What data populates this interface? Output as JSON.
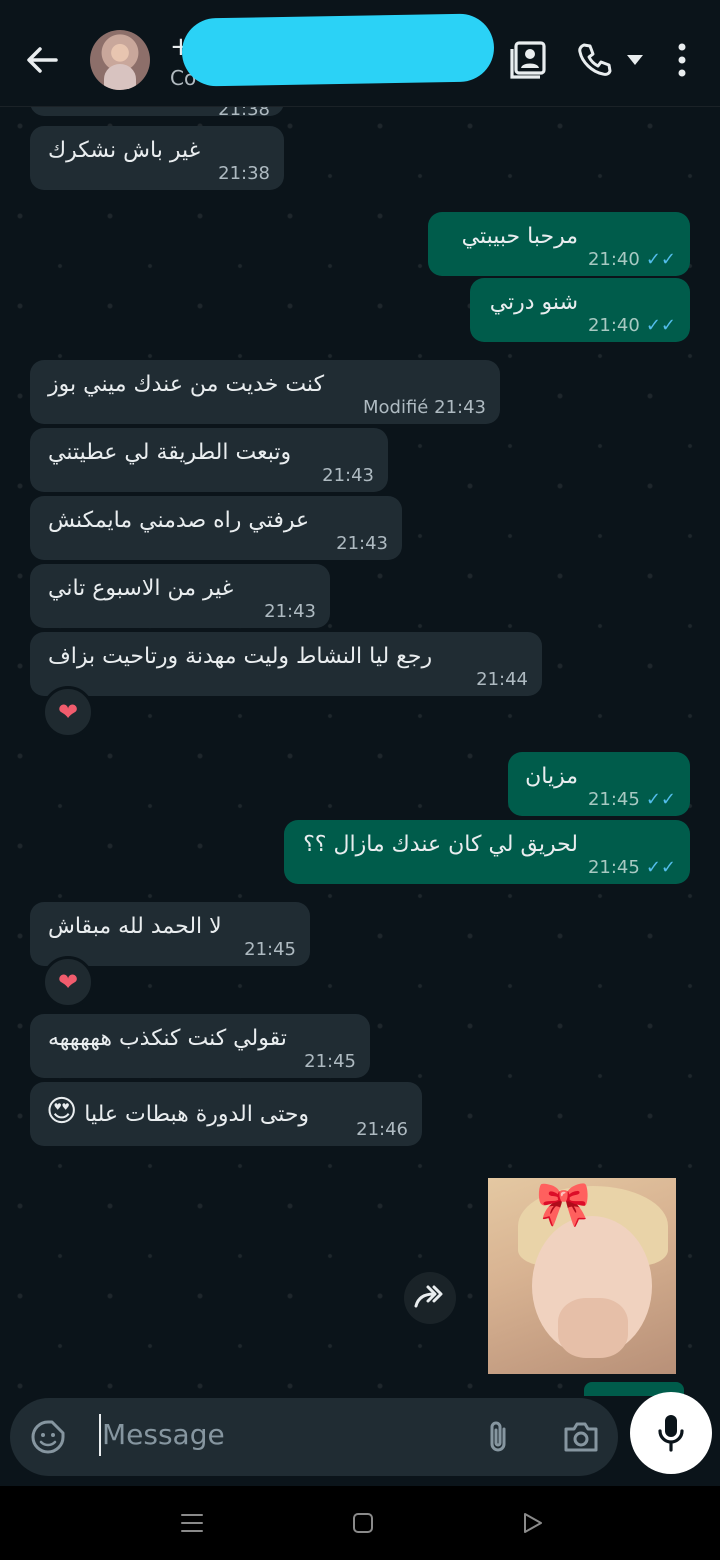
{
  "header": {
    "contact_prefix": "+",
    "contact_sub": "Co",
    "icons": [
      "back-arrow-icon",
      "avatar",
      "contact-card-icon",
      "phone-icon",
      "dropdown-icon",
      "more-vert-icon"
    ]
  },
  "messages": [
    {
      "dir": "in",
      "text": "21:38",
      "partial": true
    },
    {
      "dir": "in",
      "text": "غير باش نشكرك",
      "time": "21:38"
    },
    {
      "dir": "out",
      "text": "مرحبا حبيبتي",
      "time": "21:40"
    },
    {
      "dir": "out",
      "text": "شنو درتي",
      "time": "21:40"
    },
    {
      "dir": "in",
      "text": "كنت خديت من عندك ميني بوز",
      "time": "21:43",
      "edited": "Modifié"
    },
    {
      "dir": "in",
      "text": "وتبعت الطريقة لي عطيتني",
      "time": "21:43"
    },
    {
      "dir": "in",
      "text": "عرفتي راه صدمني مايمكنش",
      "time": "21:43"
    },
    {
      "dir": "in",
      "text": "غير من الاسبوع تاني",
      "time": "21:43"
    },
    {
      "dir": "in",
      "text": "رجع ليا النشاط وليت مهدنة ورتاحيت بزاف",
      "time": "21:44",
      "reaction": "❤"
    },
    {
      "dir": "out",
      "text": "مزيان",
      "time": "21:45"
    },
    {
      "dir": "out",
      "text": "لحريق لي كان عندك مازال ؟؟",
      "time": "21:45"
    },
    {
      "dir": "in",
      "text": "لا الحمد لله مبقاش",
      "time": "21:45",
      "reaction": "❤"
    },
    {
      "dir": "in",
      "text": "تقولي كنت كنكذب هههههه",
      "time": "21:45"
    },
    {
      "dir": "in",
      "text": "وحتى الدورة هبطات عليا",
      "emoji": "😍",
      "time": "21:46"
    }
  ],
  "ticks": "✓✓",
  "input": {
    "placeholder": "Message"
  },
  "colors": {
    "incoming": "#202c33",
    "outgoing": "#005c4b",
    "background": "#0b141a",
    "ticks": "#53bdeb"
  }
}
